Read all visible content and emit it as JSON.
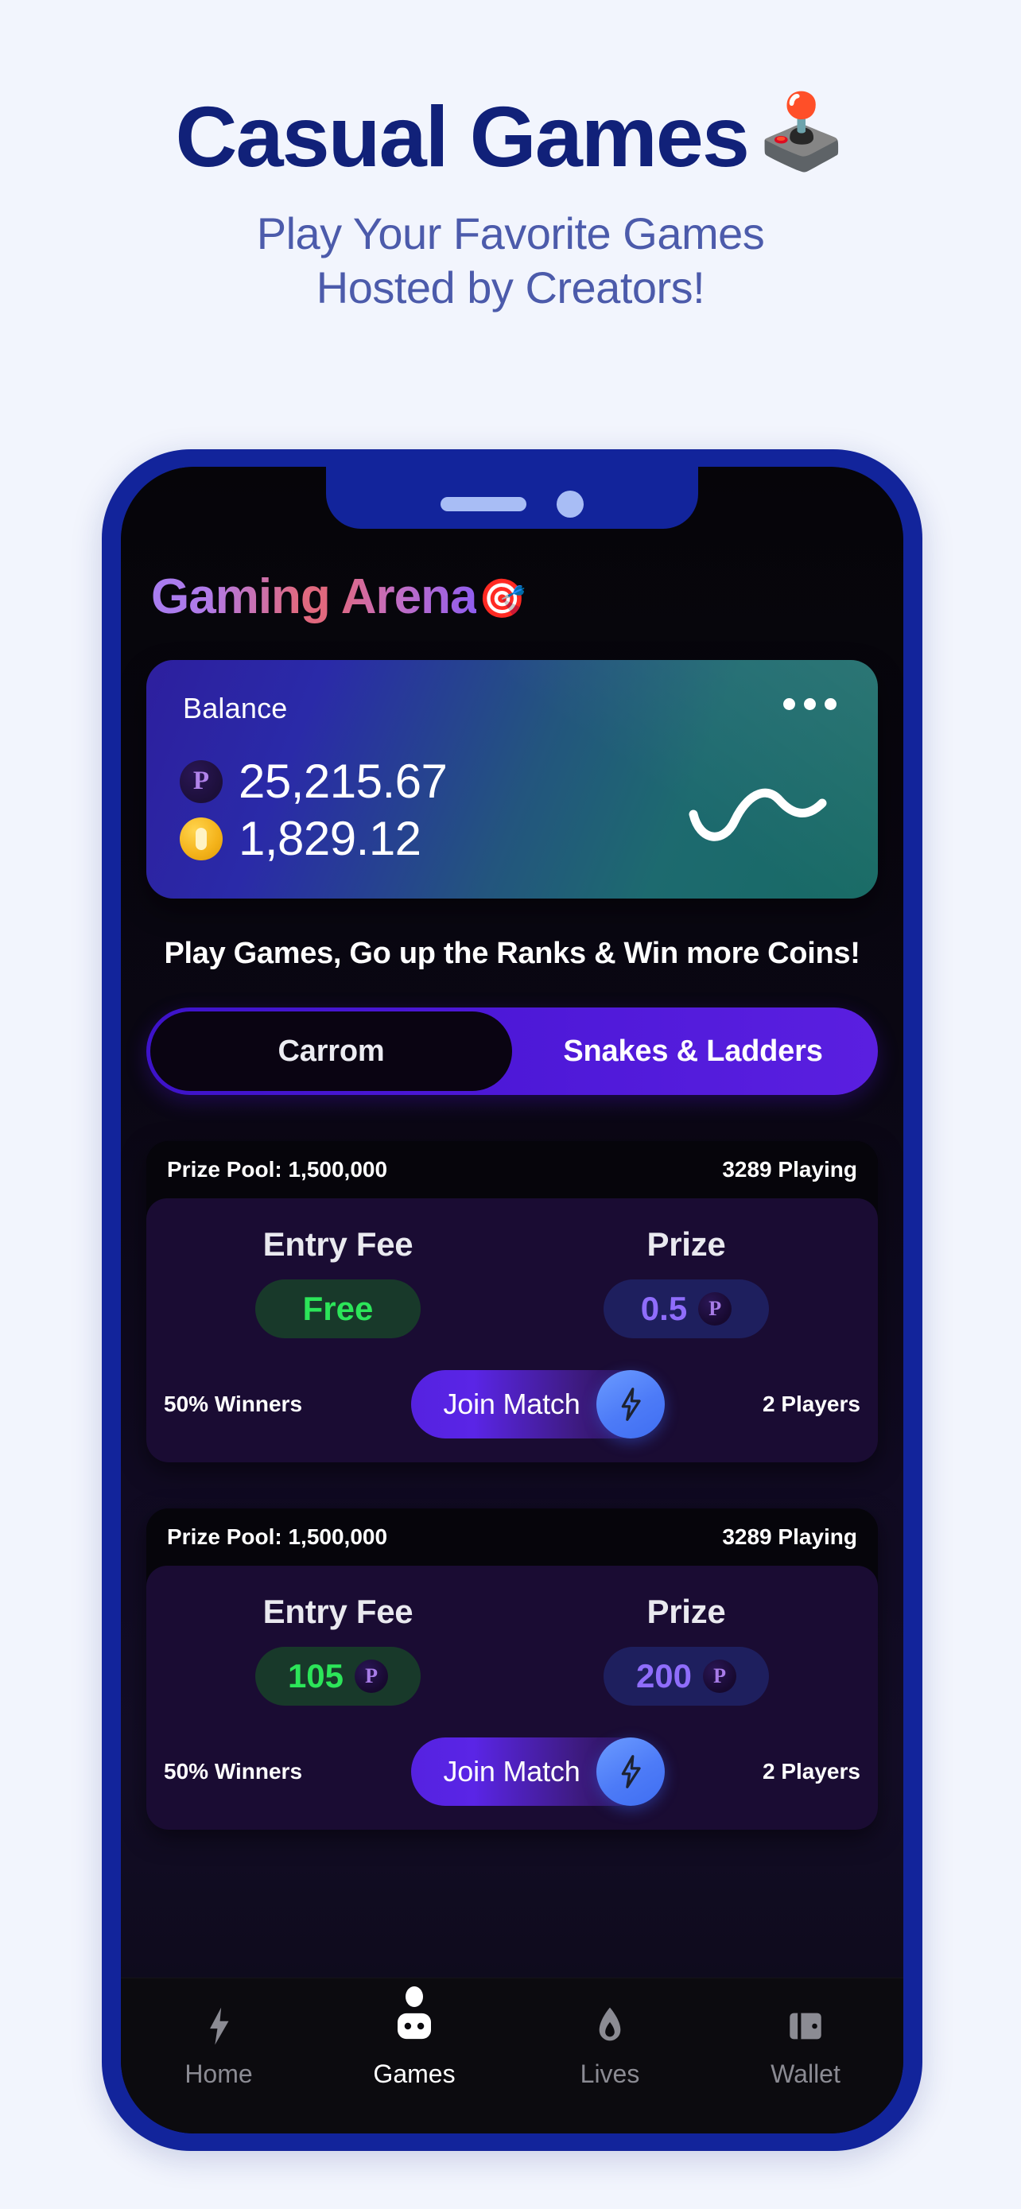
{
  "promo": {
    "title": "Casual Games",
    "joystick_icon": "joystick-emoji",
    "subtitle_line1": "Play Your Favorite Games",
    "subtitle_line2": "Hosted by Creators!",
    "title_color": "#112179",
    "subtitle_color": "#4c5bab",
    "background_color": "#f2f5fd"
  },
  "phone": {
    "frame_color": "#12249b",
    "screen_color": "#050509"
  },
  "app": {
    "logo_text": "Gaming Arena",
    "logo_icon": "dart-emoji"
  },
  "balance": {
    "label": "Balance",
    "menu_icon": "more-options-icon",
    "wave_icon": "wave-squiggle-icon",
    "primary_coin_icon": "p-coin-icon",
    "primary_amount": "25,215.67",
    "secondary_coin_icon": "gold-coin-icon",
    "secondary_amount": "1,829.12",
    "gradient_from": "#2d1f9e",
    "gradient_to": "#176a64"
  },
  "tagline": "Play Games, Go up the Ranks & Win more Coins!",
  "game_toggle": {
    "options": [
      {
        "label": "Carrom",
        "active": true
      },
      {
        "label": "Snakes & Ladders",
        "active": false
      }
    ],
    "track_color": "#4b17d6",
    "active_color": "#0a0412"
  },
  "matches": [
    {
      "prize_pool": "Prize Pool: 1,500,000",
      "playing": "3289 Playing",
      "entry_fee_title": "Entry Fee",
      "entry_fee_value": "Free",
      "entry_fee_coin": "",
      "prize_title": "Prize",
      "prize_value": "0.5",
      "prize_coin": "P",
      "winners": "50% Winners",
      "join_label": "Join Match",
      "bolt_icon": "lightning-bolt-icon",
      "players": "2 Players"
    },
    {
      "prize_pool": "Prize Pool: 1,500,000",
      "playing": "3289 Playing",
      "entry_fee_title": "Entry Fee",
      "entry_fee_value": "105",
      "entry_fee_coin": "P",
      "prize_title": "Prize",
      "prize_value": "200",
      "prize_coin": "P",
      "winners": "50% Winners",
      "join_label": "Join Match",
      "bolt_icon": "lightning-bolt-icon",
      "players": "2 Players"
    }
  ],
  "bottom_nav": [
    {
      "label": "Home",
      "icon": "lightning-icon",
      "active": false
    },
    {
      "label": "Games",
      "icon": "gamepad-icon",
      "active": true
    },
    {
      "label": "Lives",
      "icon": "flame-icon",
      "active": false
    },
    {
      "label": "Wallet",
      "icon": "wallet-icon",
      "active": false
    }
  ]
}
